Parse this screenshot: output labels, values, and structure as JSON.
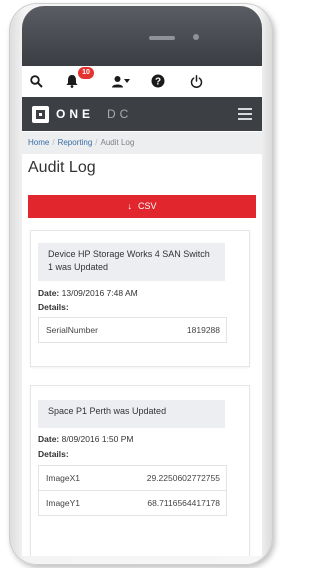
{
  "topbar": {
    "notification_count": "10",
    "icons": [
      "search-icon",
      "bell-icon",
      "user-icon",
      "help-icon",
      "power-icon"
    ]
  },
  "brand": {
    "name_bold": "ONE",
    "name_light": "DC"
  },
  "breadcrumb": {
    "home": "Home",
    "reporting": "Reporting",
    "current": "Audit Log",
    "separator": "/"
  },
  "page": {
    "title": "Audit Log",
    "csv_label": "CSV"
  },
  "entries": [
    {
      "title": "Device HP Storage Works 4 SAN Switch 1 was Updated",
      "date_label": "Date:",
      "date": "13/09/2016 7:48 AM",
      "details_label": "Details:",
      "details": [
        {
          "key": "SerialNumber",
          "value": "1819288"
        }
      ]
    },
    {
      "title": "Space P1 Perth was Updated",
      "date_label": "Date:",
      "date": "8/09/2016 1:50 PM",
      "details_label": "Details:",
      "details": [
        {
          "key": "ImageX1",
          "value": "29.2250602772755"
        },
        {
          "key": "ImageY1",
          "value": "68.7116564417178"
        }
      ]
    }
  ],
  "colors": {
    "brand_bar": "#3c3f44",
    "csv_button": "#e1262d",
    "badge": "#e3342f",
    "link": "#3a6ea5"
  }
}
